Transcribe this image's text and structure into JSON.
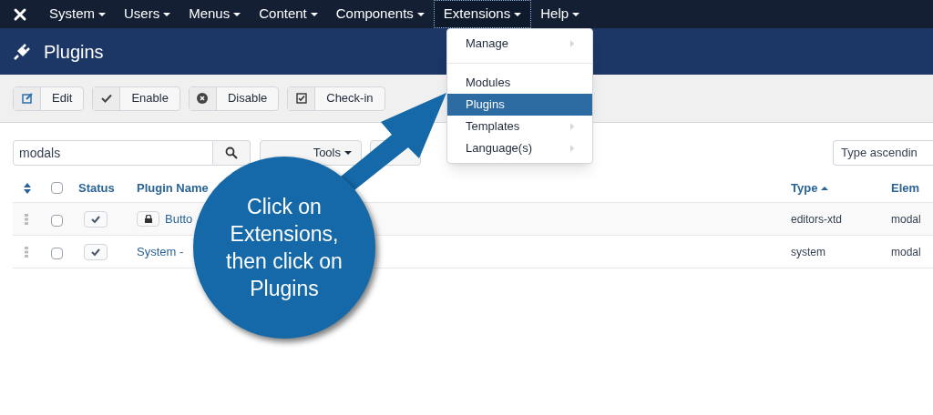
{
  "menubar": {
    "items": [
      {
        "label": "System",
        "selected": false
      },
      {
        "label": "Users",
        "selected": false
      },
      {
        "label": "Menus",
        "selected": false
      },
      {
        "label": "Content",
        "selected": false
      },
      {
        "label": "Components",
        "selected": false
      },
      {
        "label": "Extensions",
        "selected": true
      },
      {
        "label": "Help",
        "selected": false
      }
    ]
  },
  "dropdown": {
    "items": [
      {
        "kind": "item",
        "label": "Manage",
        "submenu": true,
        "selected": false
      },
      {
        "kind": "divider"
      },
      {
        "kind": "item",
        "label": "Modules",
        "submenu": false,
        "selected": false
      },
      {
        "kind": "item",
        "label": "Plugins",
        "submenu": false,
        "selected": true
      },
      {
        "kind": "item",
        "label": "Templates",
        "submenu": true,
        "selected": false
      },
      {
        "kind": "item",
        "label": "Language(s)",
        "submenu": true,
        "selected": false
      }
    ]
  },
  "header": {
    "title": "Plugins"
  },
  "toolbar": [
    {
      "kind": "edit",
      "label": "Edit"
    },
    {
      "kind": "check",
      "label": "Enable"
    },
    {
      "kind": "disable",
      "label": "Disable"
    },
    {
      "kind": "checkin",
      "label": "Check-in"
    }
  ],
  "filters": {
    "search_value": "modals",
    "tools_label": "Tools",
    "sort_value": "Type ascendin"
  },
  "table": {
    "columns": [
      "Status",
      "Plugin Name",
      "Type",
      "Elem"
    ],
    "select_all_checked": false,
    "rows": [
      {
        "checked": false,
        "locked": true,
        "enabled": true,
        "name": "Butto",
        "type": "editors-xtd",
        "element": "modal"
      },
      {
        "checked": false,
        "locked": false,
        "enabled": true,
        "name": "System -",
        "type": "system",
        "element": "modal"
      }
    ]
  },
  "callout": {
    "text": "Click on Extensions, then click on Plugins"
  }
}
